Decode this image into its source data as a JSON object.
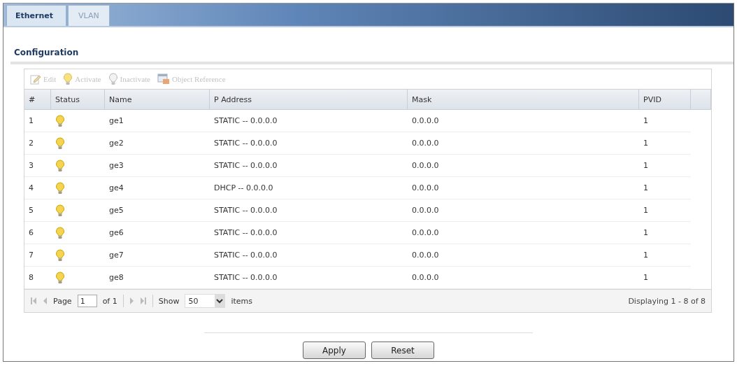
{
  "tabs": [
    {
      "label": "Ethernet",
      "selected": true
    },
    {
      "label": "VLAN",
      "selected": false
    }
  ],
  "section_title": "Configuration",
  "toolbar": [
    {
      "kind": "edit",
      "label": "Edit",
      "disabled": true
    },
    {
      "kind": "activate",
      "label": "Activate",
      "disabled": true
    },
    {
      "kind": "inactivate",
      "label": "Inactivate",
      "disabled": true
    },
    {
      "kind": "reference",
      "label": "Object Reference",
      "disabled": true
    }
  ],
  "table": {
    "columns": [
      "#",
      "Status",
      "Name",
      "P Address",
      "Mask",
      "PVID"
    ],
    "rows": [
      {
        "index": "1",
        "active": true,
        "name": "ge1",
        "ip_address": "STATIC -- 0.0.0.0",
        "mask": "0.0.0.0",
        "pvid": "1"
      },
      {
        "index": "2",
        "active": true,
        "name": "ge2",
        "ip_address": "STATIC -- 0.0.0.0",
        "mask": "0.0.0.0",
        "pvid": "1"
      },
      {
        "index": "3",
        "active": true,
        "name": "ge3",
        "ip_address": "STATIC -- 0.0.0.0",
        "mask": "0.0.0.0",
        "pvid": "1"
      },
      {
        "index": "4",
        "active": true,
        "name": "ge4",
        "ip_address": "DHCP -- 0.0.0.0",
        "mask": "0.0.0.0",
        "pvid": "1"
      },
      {
        "index": "5",
        "active": true,
        "name": "ge5",
        "ip_address": "STATIC -- 0.0.0.0",
        "mask": "0.0.0.0",
        "pvid": "1"
      },
      {
        "index": "6",
        "active": true,
        "name": "ge6",
        "ip_address": "STATIC -- 0.0.0.0",
        "mask": "0.0.0.0",
        "pvid": "1"
      },
      {
        "index": "7",
        "active": true,
        "name": "ge7",
        "ip_address": "STATIC -- 0.0.0.0",
        "mask": "0.0.0.0",
        "pvid": "1"
      },
      {
        "index": "8",
        "active": true,
        "name": "ge8",
        "ip_address": "STATIC -- 0.0.0.0",
        "mask": "0.0.0.0",
        "pvid": "1"
      }
    ]
  },
  "pager": {
    "page_label": "Page",
    "page": "1",
    "of_label": "of 1",
    "show_label": "Show",
    "page_size": "50",
    "items_label": "items",
    "summary": "Displaying 1 - 8 of 8"
  },
  "buttons": [
    {
      "label": "Apply"
    },
    {
      "label": "Reset"
    }
  ]
}
